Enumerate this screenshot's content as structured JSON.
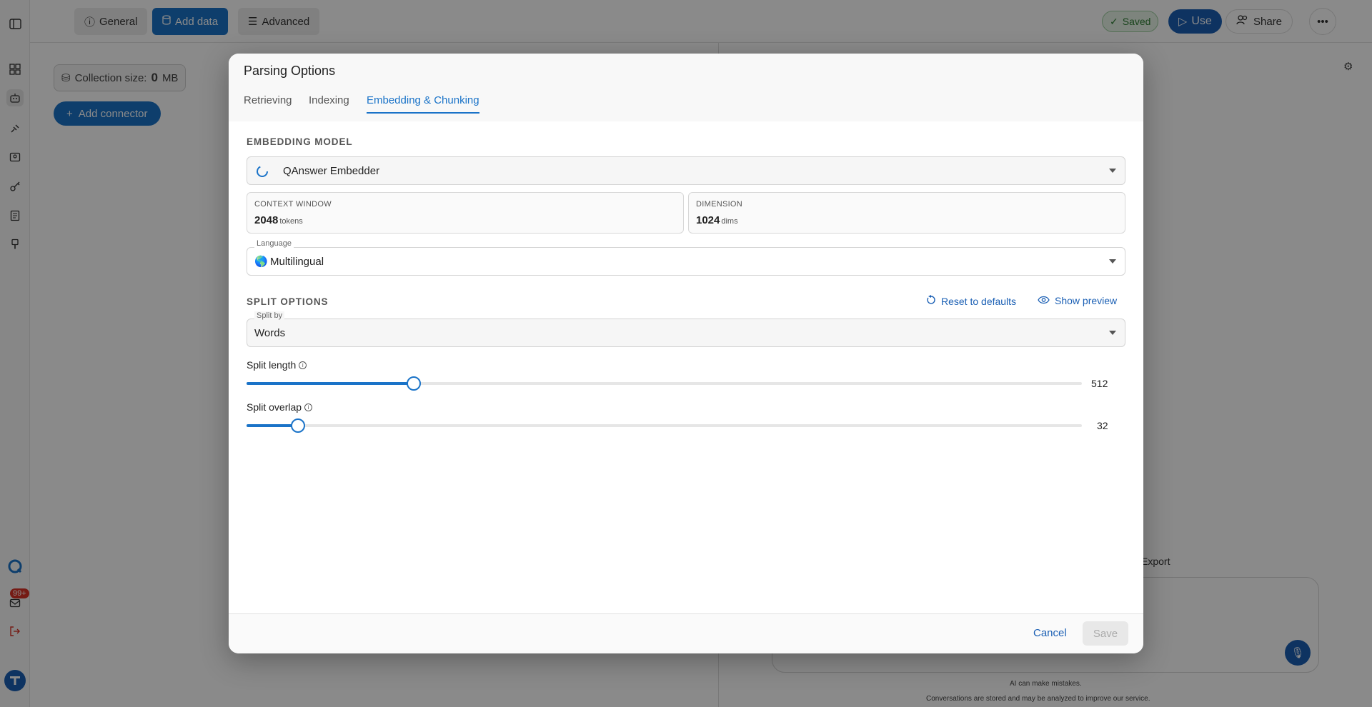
{
  "topbar": {
    "general": "General",
    "add_data": "Add data",
    "advanced": "Advanced",
    "saved": "Saved",
    "use": "Use",
    "share": "Share"
  },
  "sidebar": {
    "badge": "99+"
  },
  "background": {
    "collection_size_label": "Collection size:",
    "collection_size_value": "0",
    "collection_size_unit": "MB",
    "add_connector": "Add connector",
    "export": "Export",
    "ai_notice": "AI can make mistakes.",
    "conversation_notice": "Conversations are stored and may be analyzed to improve our service."
  },
  "modal": {
    "title": "Parsing Options",
    "tabs": [
      {
        "label": "Retrieving",
        "active": false
      },
      {
        "label": "Indexing",
        "active": false
      },
      {
        "label": "Embedding & Chunking",
        "active": true
      }
    ],
    "embedding": {
      "section_label": "EMBEDDING MODEL",
      "model": "QAnswer Embedder",
      "context_window_label": "CONTEXT WINDOW",
      "context_window_value": "2048",
      "context_window_unit": "tokens",
      "dimension_label": "DIMENSION",
      "dimension_value": "1024",
      "dimension_unit": "dims",
      "language_legend": "Language",
      "language_flag": "🌎",
      "language_value": "Multilingual"
    },
    "split": {
      "section_label": "SPLIT OPTIONS",
      "reset_label": "Reset to defaults",
      "preview_label": "Show preview",
      "split_by_legend": "Split by",
      "split_by_value": "Words",
      "length_label": "Split length",
      "length_value": "512",
      "length_fraction": 0.2,
      "overlap_label": "Split overlap",
      "overlap_value": "32",
      "overlap_fraction": 0.062
    },
    "footer": {
      "cancel": "Cancel",
      "save": "Save"
    }
  },
  "colors": {
    "accent": "#1a73c8",
    "primary_dark": "#1a5fb4",
    "saved_green": "#2e7d32",
    "badge_red": "#d93025"
  }
}
